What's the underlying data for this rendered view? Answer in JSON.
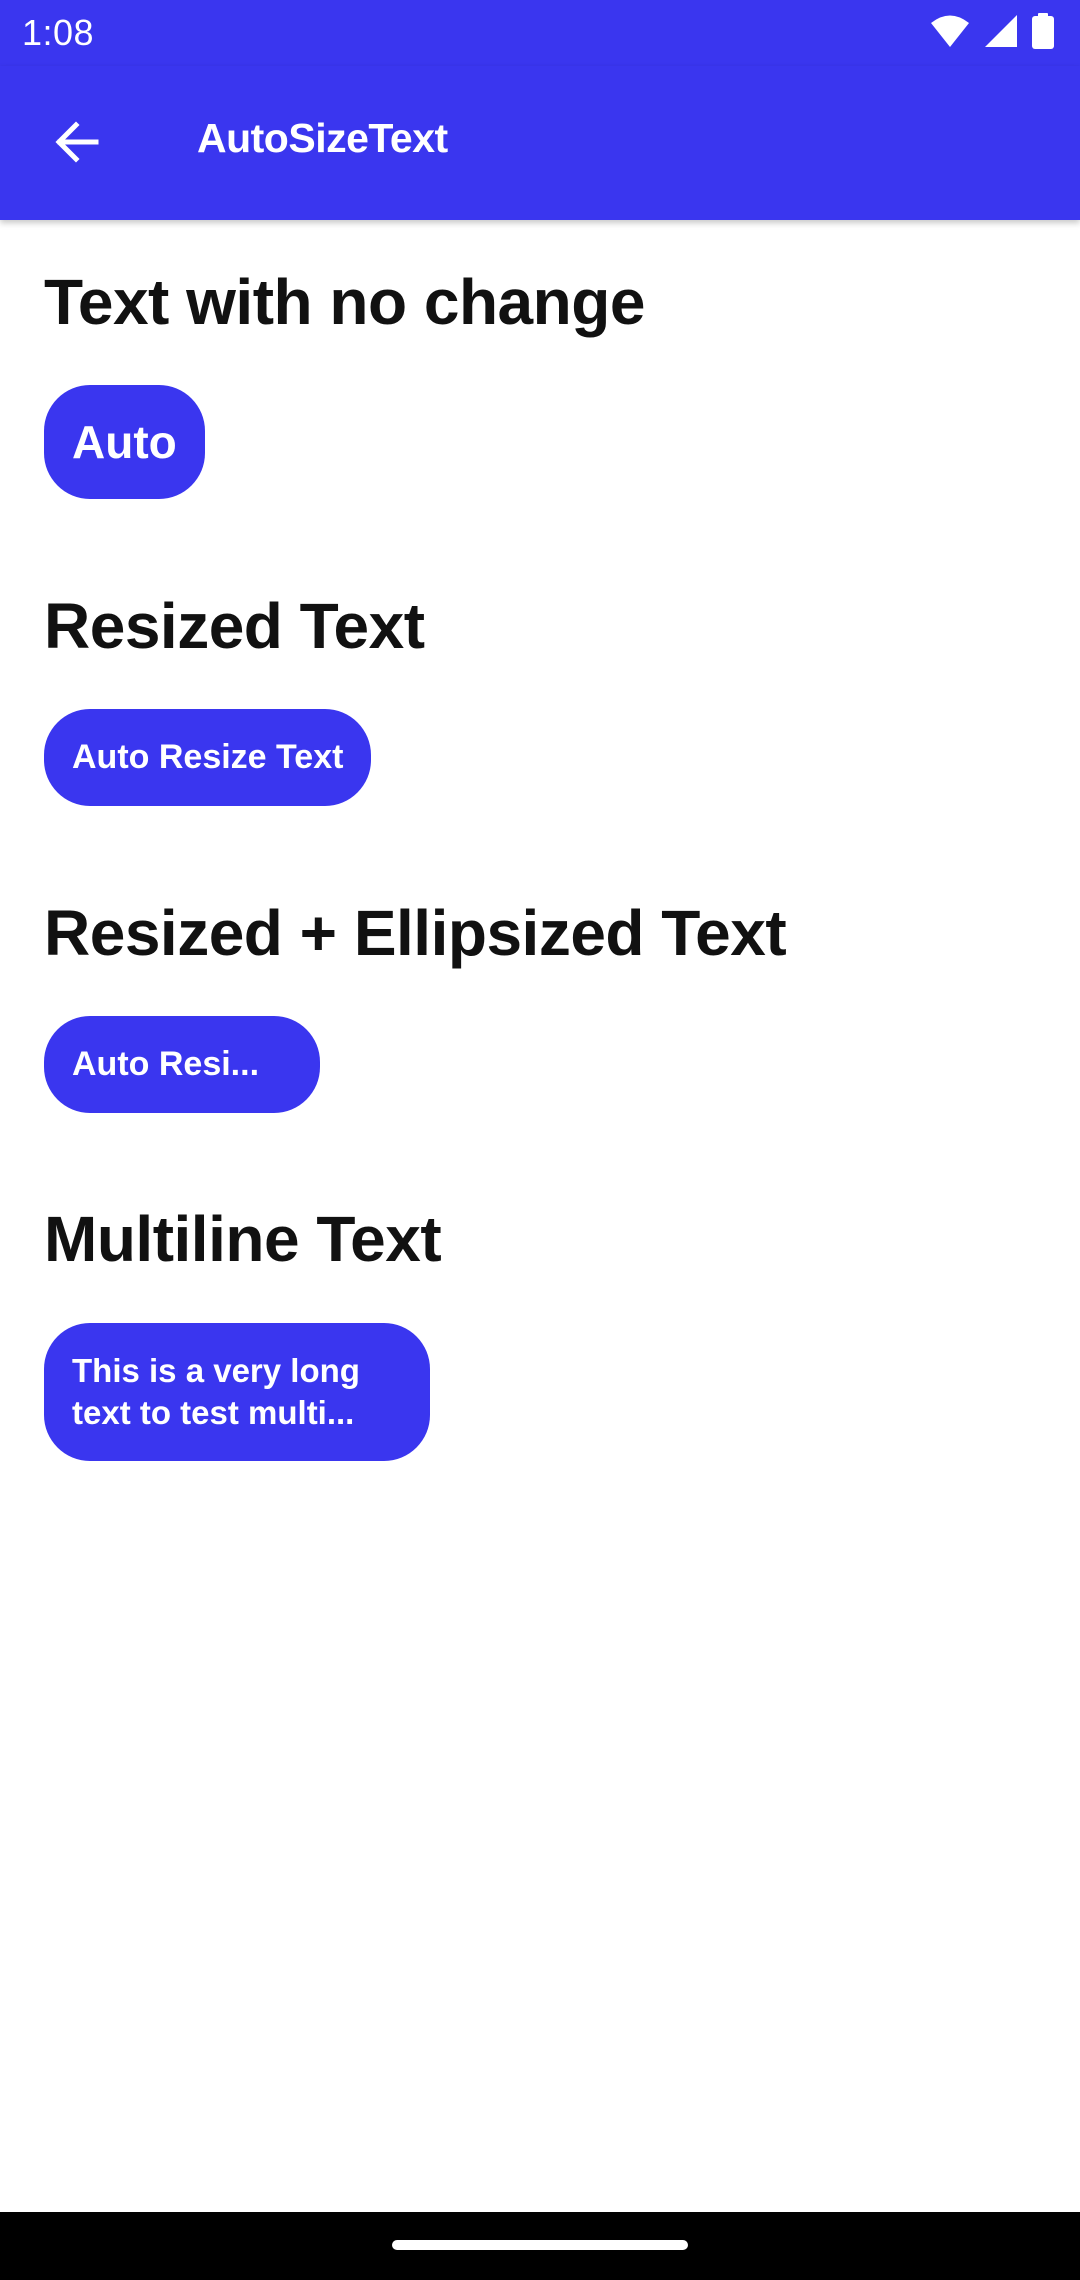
{
  "status_bar": {
    "time": "1:08",
    "icons": [
      "wifi-icon",
      "signal-icon",
      "battery-icon"
    ]
  },
  "app_bar": {
    "title": "AutoSizeText",
    "back_icon": "arrow-back-icon"
  },
  "sections": [
    {
      "title": "Text with no change",
      "button_label": "Auto"
    },
    {
      "title": "Resized Text",
      "button_label": "Auto Resize Text"
    },
    {
      "title": "Resized + Ellipsized Text",
      "button_label": "Auto Resi..."
    },
    {
      "title": "Multiline Text",
      "button_lines": [
        "This is a very long",
        "text to test multi..."
      ]
    }
  ],
  "colors": {
    "accent": "#3a36ef",
    "background": "#ffffff",
    "text": "#111111",
    "nav_bar": "#000000"
  }
}
